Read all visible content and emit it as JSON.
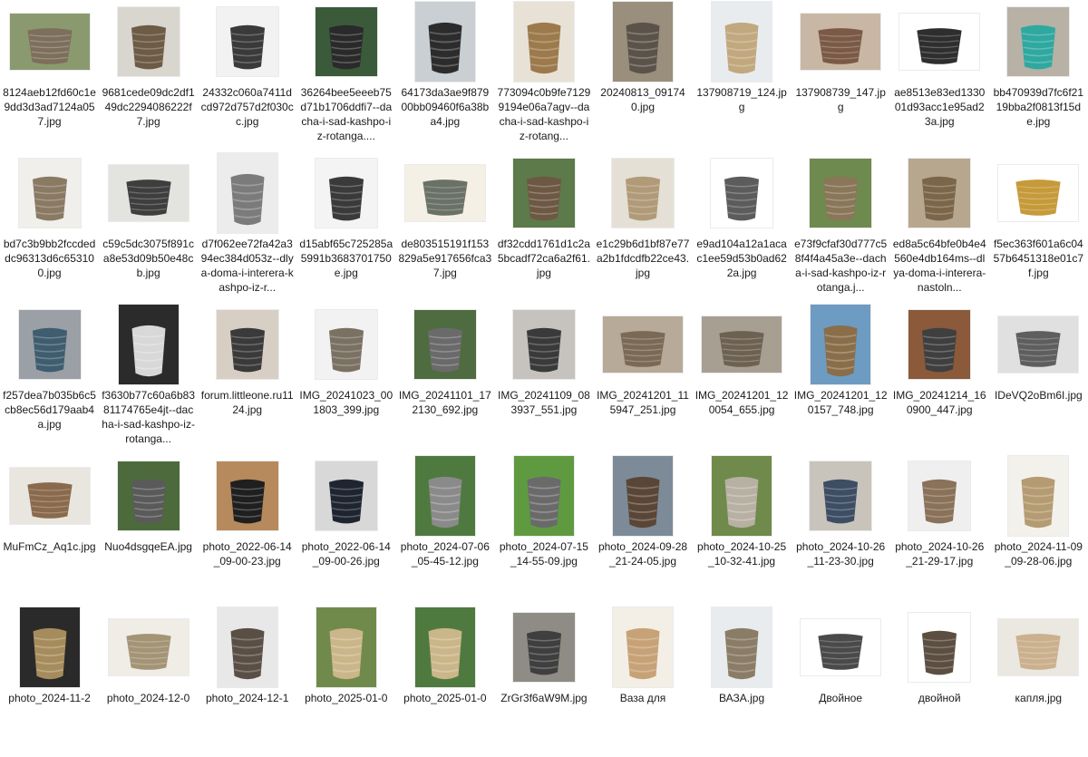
{
  "files": [
    {
      "name": "8124aeb12fd60c1e9dd3d3ad7124a057.jpg",
      "thumb": "landscape",
      "bg": "#8a9a6e",
      "fg": "#7d6f5b"
    },
    {
      "name": "9681cede09dc2df149dc2294086222f7.jpg",
      "thumb": "square",
      "bg": "#d9d6d0",
      "fg": "#6e5b45"
    },
    {
      "name": "24332c060a7411dcd972d757d2f030cc.jpg",
      "thumb": "square",
      "bg": "#f2f2f2",
      "fg": "#3a3a3a"
    },
    {
      "name": "36264bee5eeeb75d71b1706ddfi7--dacha-i-sad-kashpo-iz-rotanga....",
      "thumb": "square",
      "bg": "#3b5a3a",
      "fg": "#2a2a2a"
    },
    {
      "name": "64173da3ae9f87900bb09460f6a38ba4.jpg",
      "thumb": "portrait",
      "bg": "#c9cfd3",
      "fg": "#2c2c2c"
    },
    {
      "name": "773094c0b9fe71299194e06a7agv--dacha-i-sad-kashpo-iz-rotang...",
      "thumb": "portrait",
      "bg": "#e8e2d6",
      "fg": "#9c7a4c"
    },
    {
      "name": "20240813_091740.jpg",
      "thumb": "portrait",
      "bg": "#9a8e7c",
      "fg": "#5b534a"
    },
    {
      "name": "137908719_124.jpg",
      "thumb": "portrait",
      "bg": "#e9ecef",
      "fg": "#c2a87e"
    },
    {
      "name": "137908739_147.jpg",
      "thumb": "landscape",
      "bg": "#c8b7a5",
      "fg": "#7a5a46"
    },
    {
      "name": "ae8513e83ed133001d93acc1e95ad23a.jpg",
      "thumb": "landscape",
      "bg": "#ffffff",
      "fg": "#2e2e2e"
    },
    {
      "name": "bb470939d7fc6f2119bba2f0813f15de.jpg",
      "thumb": "square",
      "bg": "#b8b1a5",
      "fg": "#2fa8a0"
    },
    {
      "name": "bd7c3b9bb2fccdeddc96313d6c653100.jpg",
      "thumb": "square",
      "bg": "#f0efec",
      "fg": "#8a7a63"
    },
    {
      "name": "c59c5dc3075f891ca8e53d09b50e48cb.jpg",
      "thumb": "landscape",
      "bg": "#e3e3e0",
      "fg": "#3e3e3e"
    },
    {
      "name": "d7f062ee72fa42a394ec384d053z--dlya-doma-i-interera-kashpo-iz-r...",
      "thumb": "portrait",
      "bg": "#ececec",
      "fg": "#7b7b7b"
    },
    {
      "name": "d15abf65c725285a5991b3683701750e.jpg",
      "thumb": "square",
      "bg": "#f4f4f4",
      "fg": "#3a3a3a"
    },
    {
      "name": "de803515191f153829a5e917656fca37.jpg",
      "thumb": "landscape",
      "bg": "#f5f0e6",
      "fg": "#6a7166"
    },
    {
      "name": "df32cdd1761d1c2a5bcadf72ca6a2f61.jpg",
      "thumb": "square",
      "bg": "#5d7a4a",
      "fg": "#6d5843"
    },
    {
      "name": "e1c29b6d1bf87e77a2b1fdcdfb22ce43.jpg",
      "thumb": "square",
      "bg": "#e5e0d6",
      "fg": "#b09a78"
    },
    {
      "name": "e9ad104a12a1acac1ee59d53b0ad622a.jpg",
      "thumb": "square",
      "bg": "#ffffff",
      "fg": "#5c5c5c"
    },
    {
      "name": "e73f9cfaf30d777c58f4f4a45a3e--dacha-i-sad-kashpo-iz-rotanga.j...",
      "thumb": "square",
      "bg": "#6f8a4e",
      "fg": "#8a7659"
    },
    {
      "name": "ed8a5c64bfe0b4e4560e4db164ms--dlya-doma-i-interera-nastoln...",
      "thumb": "square",
      "bg": "#b8a78f",
      "fg": "#7b6649"
    },
    {
      "name": "f5ec363f601a6c0457b6451318e01c7f.jpg",
      "thumb": "landscape",
      "bg": "#ffffff",
      "fg": "#c69a3a"
    },
    {
      "name": "f257dea7b035b6c5cb8ec56d179aab4a.jpg",
      "thumb": "square",
      "bg": "#9aa0a6",
      "fg": "#3f5d6e"
    },
    {
      "name": "f3630b77c60a6b8381174765e4jt--dacha-i-sad-kashpo-iz-rotanga...",
      "thumb": "portrait",
      "bg": "#2b2b2b",
      "fg": "#d8d8d8"
    },
    {
      "name": "forum.littleone.ru1124.jpg",
      "thumb": "square",
      "bg": "#d7cfc4",
      "fg": "#3a3a3a"
    },
    {
      "name": "IMG_20241023_001803_399.jpg",
      "thumb": "square",
      "bg": "#f2f2f2",
      "fg": "#7a7163"
    },
    {
      "name": "IMG_20241101_172130_692.jpg",
      "thumb": "square",
      "bg": "#4f6b40",
      "fg": "#6a6a6a"
    },
    {
      "name": "IMG_20241109_083937_551.jpg",
      "thumb": "square",
      "bg": "#c6c3be",
      "fg": "#3a3a3a"
    },
    {
      "name": "IMG_20241201_115947_251.jpg",
      "thumb": "landscape",
      "bg": "#b7aa98",
      "fg": "#7a6a55"
    },
    {
      "name": "IMG_20241201_120054_655.jpg",
      "thumb": "landscape",
      "bg": "#a89f93",
      "fg": "#6d6152"
    },
    {
      "name": "IMG_20241201_120157_748.jpg",
      "thumb": "portrait",
      "bg": "#6e9bc2",
      "fg": "#8a6e4a"
    },
    {
      "name": "IMG_20241214_160900_447.jpg",
      "thumb": "square",
      "bg": "#8a5a3a",
      "fg": "#3f3f3f"
    },
    {
      "name": "IDeVQ2oBm6I.jpg",
      "thumb": "landscape",
      "bg": "#e0e0e0",
      "fg": "#5e5e5e"
    },
    {
      "name": "MuFmCz_Aq1c.jpg",
      "thumb": "landscape",
      "bg": "#e9e6e0",
      "fg": "#8a6a4c"
    },
    {
      "name": "Nuo4dsgqeEA.jpg",
      "thumb": "square",
      "bg": "#4d6a3c",
      "fg": "#5a5a5a"
    },
    {
      "name": "photo_2022-06-14_09-00-23.jpg",
      "thumb": "square",
      "bg": "#b68a5c",
      "fg": "#1f1f1f"
    },
    {
      "name": "photo_2022-06-14_09-00-26.jpg",
      "thumb": "square",
      "bg": "#d8d8d8",
      "fg": "#1f2530"
    },
    {
      "name": "photo_2024-07-06_05-45-12.jpg",
      "thumb": "portrait",
      "bg": "#4f7a3f",
      "fg": "#8a8a8a"
    },
    {
      "name": "photo_2024-07-15_14-55-09.jpg",
      "thumb": "portrait",
      "bg": "#5f9a40",
      "fg": "#6a6a6a"
    },
    {
      "name": "photo_2024-09-28_21-24-05.jpg",
      "thumb": "portrait",
      "bg": "#7d8b99",
      "fg": "#5a4636"
    },
    {
      "name": "photo_2024-10-25_10-32-41.jpg",
      "thumb": "portrait",
      "bg": "#6f8a4a",
      "fg": "#b8b0a3"
    },
    {
      "name": "photo_2024-10-26_11-23-30.jpg",
      "thumb": "square",
      "bg": "#c9c4bb",
      "fg": "#3d4d63"
    },
    {
      "name": "photo_2024-10-26_21-29-17.jpg",
      "thumb": "square",
      "bg": "#efefef",
      "fg": "#8a7159"
    },
    {
      "name": "photo_2024-11-09_09-28-06.jpg",
      "thumb": "portrait",
      "bg": "#f3f1ec",
      "fg": "#b59b72"
    },
    {
      "name": "photo_2024-11-2",
      "thumb": "portrait",
      "bg": "#2a2a2a",
      "fg": "#a68c5c"
    },
    {
      "name": "photo_2024-12-0",
      "thumb": "landscape",
      "bg": "#f0ede7",
      "fg": "#a49476"
    },
    {
      "name": "photo_2024-12-1",
      "thumb": "portrait",
      "bg": "#e8e8e8",
      "fg": "#5a4f44"
    },
    {
      "name": "photo_2025-01-0",
      "thumb": "portrait",
      "bg": "#6f8a4a",
      "fg": "#cbb68a"
    },
    {
      "name": "photo_2025-01-0",
      "thumb": "portrait",
      "bg": "#4f7a3f",
      "fg": "#cbb68a"
    },
    {
      "name": "ZrGr3f6aW9M.jpg",
      "thumb": "square",
      "bg": "#8f8c85",
      "fg": "#3f3f3f"
    },
    {
      "name": "Ваза для",
      "thumb": "portrait",
      "bg": "#f4efe6",
      "fg": "#c7a277"
    },
    {
      "name": "ВАЗА.jpg",
      "thumb": "portrait",
      "bg": "#e8ecef",
      "fg": "#8a7c66"
    },
    {
      "name": "Двойное",
      "thumb": "landscape",
      "bg": "#ffffff",
      "fg": "#4a4a4a"
    },
    {
      "name": "двойной",
      "thumb": "square",
      "bg": "#ffffff",
      "fg": "#5c4f42"
    },
    {
      "name": "капля.jpg",
      "thumb": "landscape",
      "bg": "#ebe7e1",
      "fg": "#cbb08e"
    }
  ]
}
